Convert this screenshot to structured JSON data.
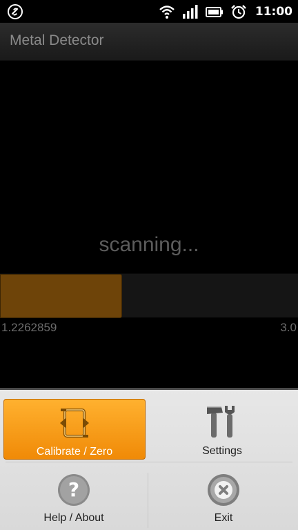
{
  "status_bar": {
    "time": "11:00",
    "icons": [
      "link-icon",
      "wifi-icon",
      "signal-icon",
      "battery-icon",
      "alarm-icon"
    ]
  },
  "app": {
    "title": "Metal Detector"
  },
  "scanner": {
    "status_text": "scanning...",
    "current_value": "1.2262859",
    "max_value": "3.0",
    "level": 1.2262859,
    "scale_max": 3.0,
    "fill_color": "#6e4409"
  },
  "menu": {
    "items": [
      {
        "label": "Calibrate / Zero",
        "icon": "calibrate-icon",
        "highlighted": true
      },
      {
        "label": "Settings",
        "icon": "tools-icon",
        "highlighted": false
      },
      {
        "label": "Help / About",
        "icon": "help-icon",
        "highlighted": false
      },
      {
        "label": "Exit",
        "icon": "exit-icon",
        "highlighted": false
      }
    ],
    "highlight_color": "#f7a01a"
  }
}
